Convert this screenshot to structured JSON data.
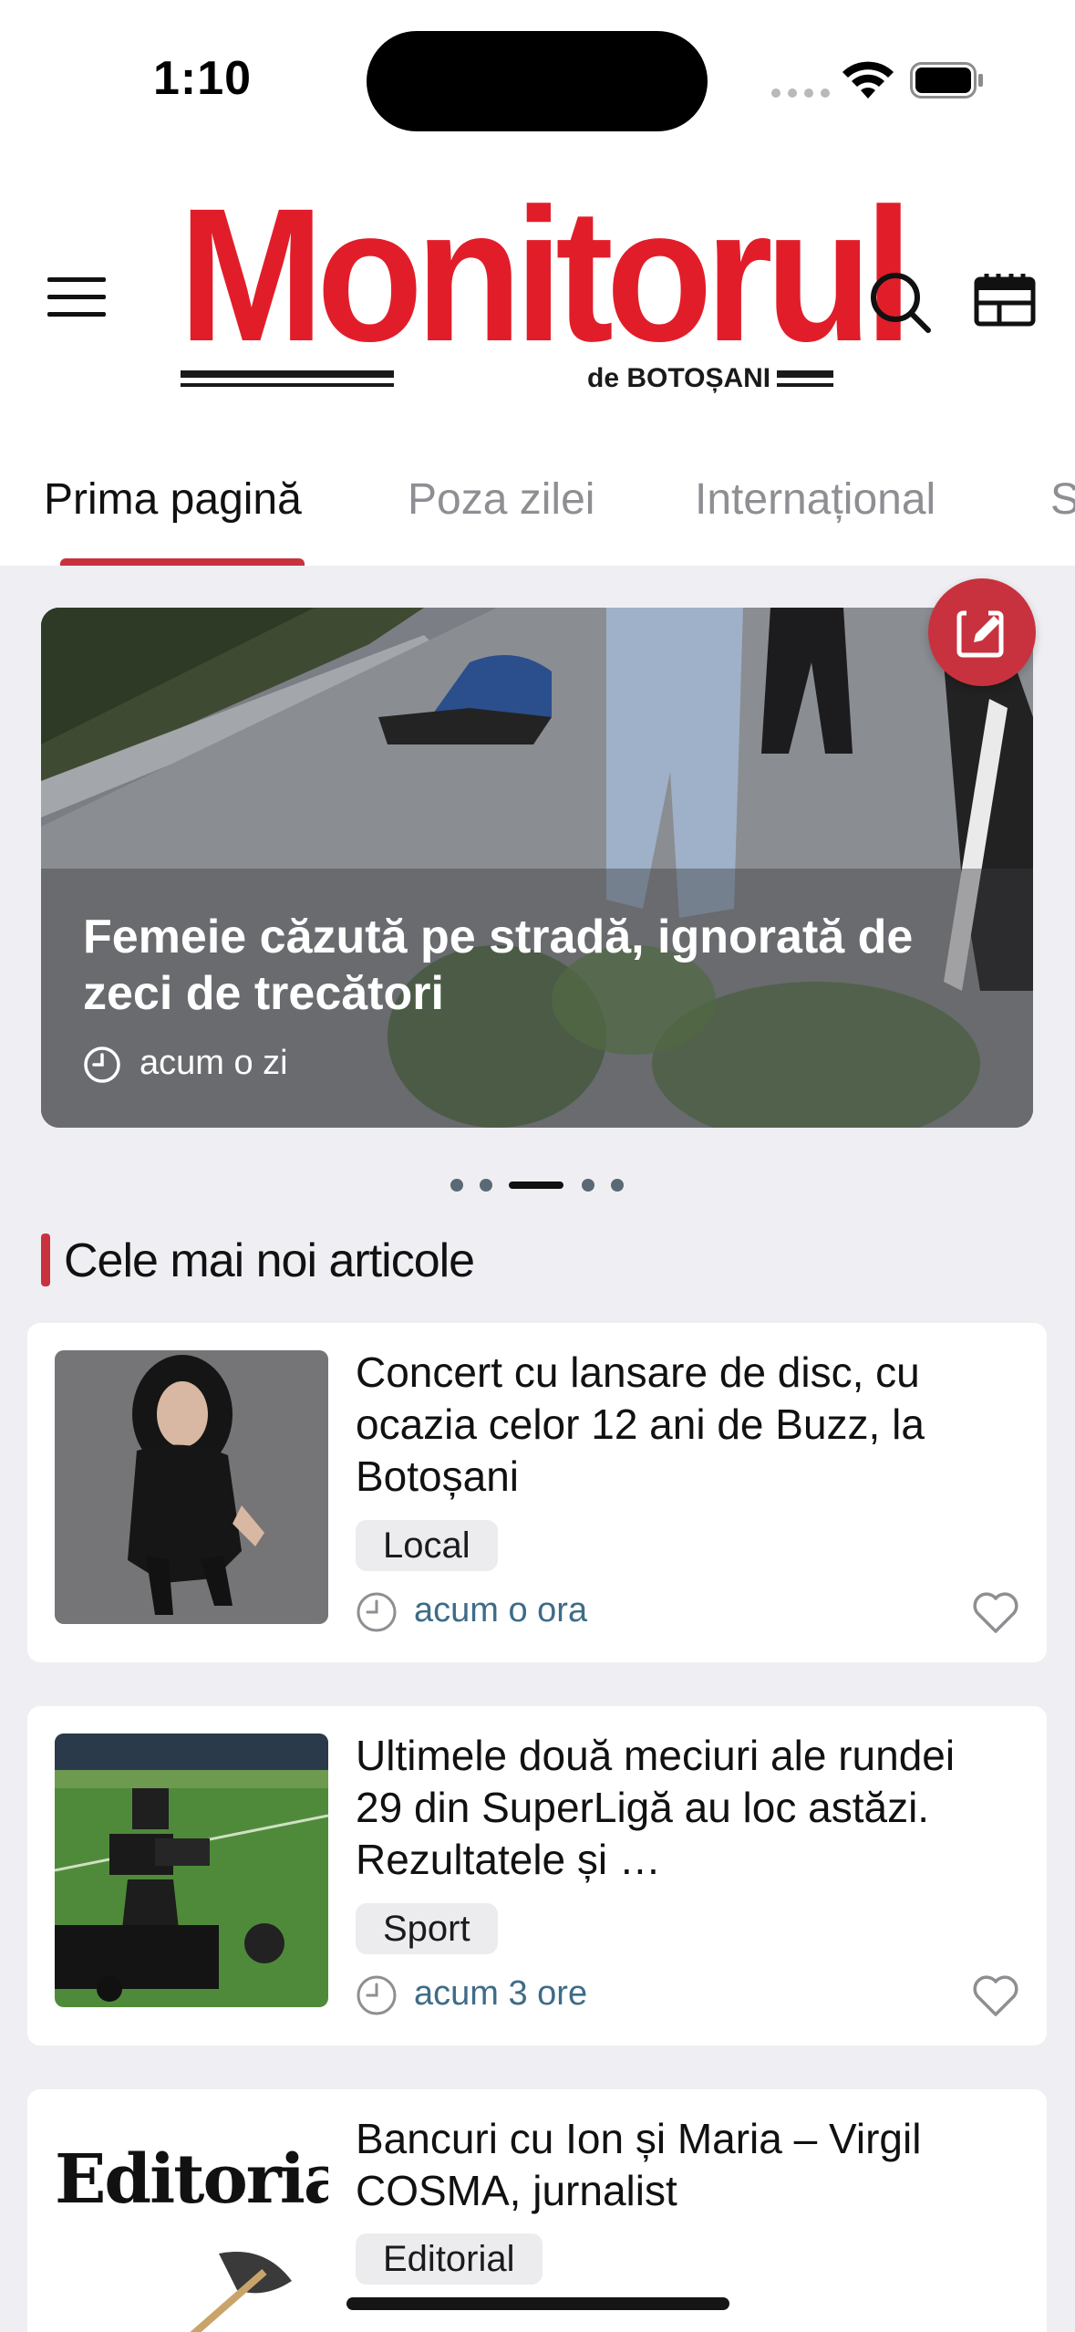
{
  "status_bar": {
    "time": "1:10"
  },
  "header": {
    "logo_text": "Monitorul",
    "logo_subtitle": "de BOTOȘANI",
    "brand_color": "#e21d2a",
    "accent_color": "#c8323f",
    "menu_icon": "hamburger-menu-icon",
    "search_icon": "search-icon",
    "edition_icon": "newspaper-edition-icon"
  },
  "tabs": [
    {
      "label": "Prima pagină",
      "active": true
    },
    {
      "label": "Poza zilei",
      "active": false
    },
    {
      "label": "Internațional",
      "active": false
    },
    {
      "label": "S",
      "active": false
    }
  ],
  "hero": {
    "title": "Femeie căzută pe stradă, ignorată de zeci de trecători",
    "time": "acum o zi",
    "carousel_count": 5,
    "carousel_active_index": 2,
    "fab_icon": "edit-note-icon"
  },
  "latest": {
    "section_title": "Cele mai noi articole",
    "articles": [
      {
        "title": "Concert cu lansare de disc, cu ocazia celor 12 ani de Buzz, la Botoșani",
        "category": "Local",
        "time": "acum o ora"
      },
      {
        "title": "Ultimele două meciuri ale rundei 29 din SuperLigă au loc astăzi. Rezultatele și …",
        "category": "Sport",
        "time": "acum 3 ore"
      },
      {
        "title": "Bancuri cu Ion și Maria – Virgil COSMA, jurnalist",
        "category": "Editorial",
        "time": ""
      }
    ],
    "thumb3_text": "Editorial"
  }
}
